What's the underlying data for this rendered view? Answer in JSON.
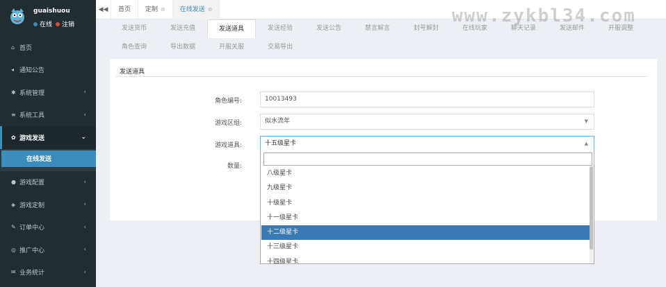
{
  "user": {
    "name": "guaishuou",
    "status": "在线",
    "logout": "注销"
  },
  "sidebar": {
    "items": [
      {
        "icon": "home-icon",
        "glyph": "⌂",
        "label": "首页",
        "has_chevron": false
      },
      {
        "icon": "bullhorn-icon",
        "glyph": "◂",
        "label": "通知公告",
        "has_chevron": false
      },
      {
        "icon": "gear-icon",
        "glyph": "✱",
        "label": "系统管理",
        "has_chevron": true
      },
      {
        "icon": "bars-icon",
        "glyph": "≡",
        "label": "系统工具",
        "has_chevron": true
      },
      {
        "icon": "game-send-icon",
        "glyph": "✿",
        "label": "游戏发送",
        "has_chevron": true,
        "expanded": true
      },
      {
        "icon": "car-icon",
        "glyph": "●",
        "label": "游戏配置",
        "has_chevron": true
      },
      {
        "icon": "shield-icon",
        "glyph": "◈",
        "label": "游戏定制",
        "has_chevron": true
      },
      {
        "icon": "pencil-icon",
        "glyph": "✎",
        "label": "订单中心",
        "has_chevron": true
      },
      {
        "icon": "eye-icon",
        "glyph": "◎",
        "label": "推广中心",
        "has_chevron": true
      },
      {
        "icon": "envelope-icon",
        "glyph": "✉",
        "label": "业务统计",
        "has_chevron": true
      }
    ],
    "subitem": "在线发送"
  },
  "topbar": {
    "back_glyph": "◀◀",
    "tabs": [
      {
        "label": "首页",
        "closable": false
      },
      {
        "label": "定制",
        "closable": true
      },
      {
        "label": "在线发送",
        "closable": true,
        "current": true
      }
    ],
    "close_glyph": "⊗"
  },
  "watermark": "www.zykbl34.com",
  "function_tabs": {
    "row1": [
      "发送货币",
      "发送充值",
      "发送道具",
      "发送经验",
      "发送公告",
      "禁言解言",
      "封号解封",
      "在线玩家",
      "聊天记录",
      "发送邮件",
      "开服调整"
    ],
    "row2": [
      "角色查询",
      "导出数据",
      "开服关服",
      "交易导出"
    ],
    "active": "发送道具"
  },
  "panel": {
    "title": "发送道具",
    "fields": {
      "role_label": "角色编号:",
      "role_value": "10013493",
      "zone_label": "游戏区组:",
      "zone_value": "似水流年",
      "item_label": "游戏道具:",
      "item_value": "十五级星卡",
      "qty_label": "数量:"
    }
  },
  "dropdown": {
    "search_value": "",
    "options": [
      "八级星卡",
      "九级星卡",
      "十级星卡",
      "十一级星卡",
      "十二级星卡",
      "十三级星卡",
      "十四级星卡"
    ],
    "selected": "十二级星卡"
  },
  "colors": {
    "accent": "#3c8dbc",
    "sidebar": "#222d32",
    "selected_option": "#3c7ab5"
  }
}
